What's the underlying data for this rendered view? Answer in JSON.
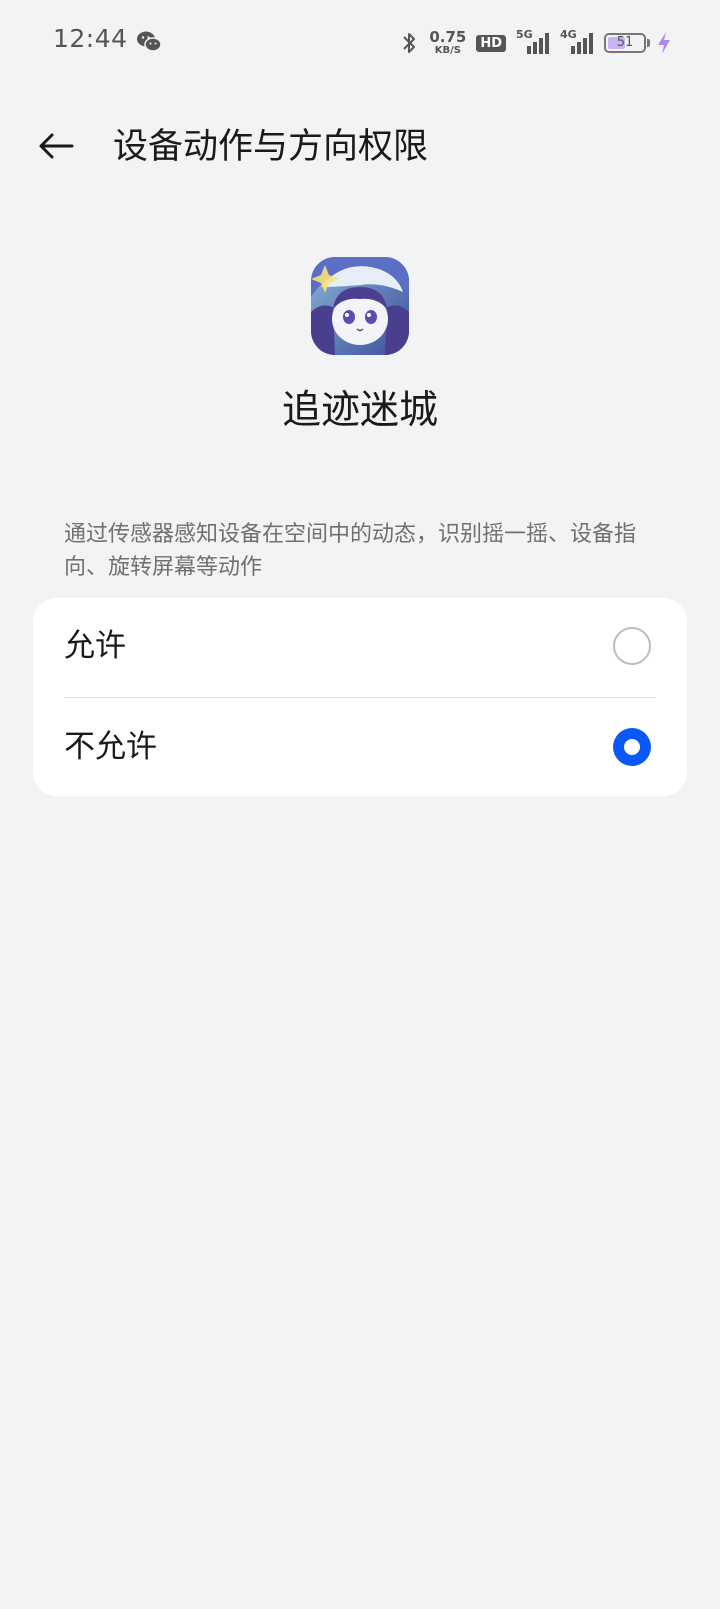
{
  "status_bar": {
    "time": "12:44",
    "net_speed_value": "0.75",
    "net_speed_unit": "KB/S",
    "hd_label": "HD",
    "signal_1_label": "5G",
    "signal_2_label": "4G",
    "battery_percent": "51",
    "battery_level": 0.51,
    "icons": [
      "wechat-icon",
      "bluetooth-icon",
      "signal-icon",
      "battery-icon",
      "charging-bolt-icon"
    ]
  },
  "header": {
    "title": "设备动作与方向权限",
    "back_icon": "arrow-left-icon"
  },
  "app": {
    "name": "追迹迷城",
    "icon": "app-icon"
  },
  "description": "通过传感器感知设备在空间中的动态，识别摇一摇、设备指向、旋转屏幕等动作",
  "options": [
    {
      "label": "允许",
      "selected": false
    },
    {
      "label": "不允许",
      "selected": true
    }
  ],
  "colors": {
    "background": "#f2f3f5",
    "accent": "#0a59f7",
    "card": "#ffffff",
    "battery_fill": "#c9b3f2",
    "bolt": "#a98bf0"
  }
}
